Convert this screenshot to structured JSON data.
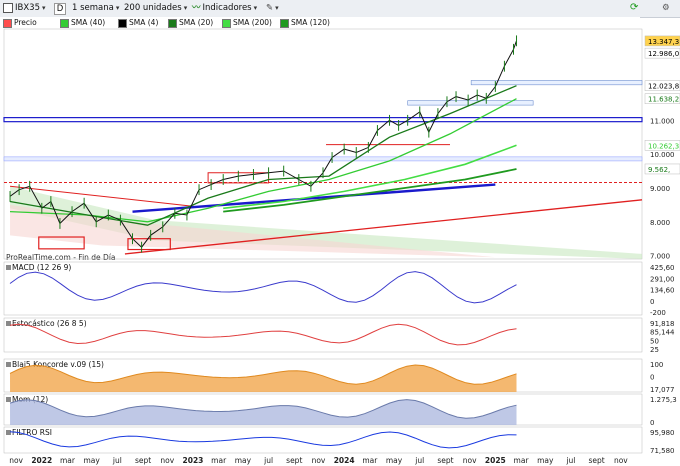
{
  "toolbar": {
    "symbol": "IBX35",
    "d_label": "D",
    "period": "1 semana",
    "units": "200 unidades",
    "indicators": "Indicadores"
  },
  "legend": [
    {
      "label": "Precio",
      "color": "#ff4d4d"
    },
    {
      "label": "SMA (40)",
      "color": "#33cc33"
    },
    {
      "label": "SMA (4)",
      "color": "#000000"
    },
    {
      "label": "SMA (20)",
      "color": "#1a7a1a"
    },
    {
      "label": "SMA (200)",
      "color": "#44dd44"
    },
    {
      "label": "SMA (120)",
      "color": "#1f9a1f"
    }
  ],
  "watermark": "ProRealTime.com - Fin de Día",
  "price_badges": [
    {
      "text": "13.347,3",
      "value": 13347.3,
      "bg": "#ffd24d",
      "fg": "#000"
    },
    {
      "text": "12.986,0",
      "value": 12986.0,
      "bg": "#ffffff",
      "fg": "#000"
    },
    {
      "text": "12.023,8",
      "value": 12023.8,
      "bg": "#ffffff",
      "fg": "#000"
    },
    {
      "text": "11.638,2",
      "value": 11638.2,
      "bg": "#ffffff",
      "fg": "#1a7a1a"
    },
    {
      "text": "10.262,3",
      "value": 10262.3,
      "bg": "#ffffff",
      "fg": "#33cc33"
    },
    {
      "text": "9.562,",
      "value": 9562,
      "bg": "#ffffff",
      "fg": "#1a7a1a"
    }
  ],
  "indicator_labels": {
    "macd": "MACD (12 26 9)",
    "stoch": "Estocástico (26 8 5)",
    "blai5": "Blai5 Koncorde v.09 (15)",
    "mom": "Mom (12)",
    "rsi": "FILTRO RSI"
  },
  "indicator_values": {
    "macd": [
      "425,60",
      "291,00",
      "134,60",
      "0",
      "-200"
    ],
    "stoch": [
      "91,818",
      "85,144",
      "50",
      "25"
    ],
    "blai5": [
      "100",
      "0",
      "17,077"
    ],
    "mom": [
      "1.275,3",
      "0"
    ],
    "rsi": [
      "95,980",
      "71,580"
    ]
  },
  "chart_data": {
    "type": "line",
    "title": "",
    "xlabel": "",
    "ylabel": "",
    "ylim": [
      6900,
      13700
    ],
    "y_ticks": [
      {
        "label": "13.347,3",
        "value": 13347.3
      },
      {
        "label": "12.986,0",
        "value": 12986
      },
      {
        "label": "12.023,8",
        "value": 12023.8
      },
      {
        "label": "11.638,2",
        "value": 11638.2
      },
      {
        "label": "11.000",
        "value": 11000
      },
      {
        "label": "10.262,3",
        "value": 10262.3
      },
      {
        "label": "10.000",
        "value": 10000
      },
      {
        "label": "9.562,",
        "value": 9562
      },
      {
        "label": "9.000",
        "value": 9000
      },
      {
        "label": "8.000",
        "value": 8000
      },
      {
        "label": "7.000",
        "value": 7000
      }
    ],
    "x_ticks": [
      "nov",
      "2022",
      "mar",
      "may",
      "jul",
      "sept",
      "nov",
      "2023",
      "mar",
      "may",
      "jul",
      "sept",
      "nov",
      "2024",
      "mar",
      "may",
      "jul",
      "sept",
      "nov",
      "2025",
      "mar",
      "may",
      "jul",
      "sept",
      "nov"
    ],
    "x_range": [
      2021.75,
      2025.97
    ],
    "grid": false,
    "price_line_series": {
      "name": "Precio",
      "x": [
        2021.79,
        2021.85,
        2021.92,
        2022.0,
        2022.06,
        2022.12,
        2022.2,
        2022.28,
        2022.36,
        2022.44,
        2022.52,
        2022.6,
        2022.66,
        2022.72,
        2022.8,
        2022.88,
        2022.96,
        2023.04,
        2023.12,
        2023.2,
        2023.3,
        2023.4,
        2023.5,
        2023.6,
        2023.7,
        2023.78,
        2023.86,
        2023.92,
        2024.0,
        2024.08,
        2024.16,
        2024.22,
        2024.3,
        2024.36,
        2024.42,
        2024.5,
        2024.56,
        2024.62,
        2024.68,
        2024.74,
        2024.82,
        2024.88,
        2024.94,
        2025.0,
        2025.06,
        2025.12,
        2025.14
      ],
      "values": [
        8750,
        8950,
        9050,
        8400,
        8600,
        7950,
        8300,
        8550,
        8000,
        8200,
        8050,
        7500,
        7250,
        7600,
        7850,
        8250,
        8200,
        8950,
        9100,
        9250,
        9350,
        9400,
        9450,
        9500,
        9250,
        9050,
        9450,
        9900,
        10150,
        10050,
        10200,
        10700,
        11000,
        10850,
        11000,
        11250,
        10650,
        11200,
        11550,
        11700,
        11600,
        11750,
        11650,
        12000,
        12600,
        13100,
        13350
      ]
    },
    "series": [
      {
        "name": "SMA (40)",
        "x": [
          2021.79,
          2022.3,
          2022.7,
          2023.1,
          2023.5,
          2023.9,
          2024.3,
          2024.7,
          2025.14
        ],
        "values": [
          8300,
          8200,
          8000,
          8400,
          8900,
          9250,
          9800,
          10600,
          11638.2
        ]
      },
      {
        "name": "SMA (20)",
        "x": [
          2021.79,
          2022.3,
          2022.7,
          2023.1,
          2023.5,
          2023.9,
          2024.3,
          2024.7,
          2025.14
        ],
        "values": [
          8600,
          8200,
          7900,
          8700,
          9250,
          9350,
          10500,
          11200,
          12023.8
        ]
      },
      {
        "name": "SMA (200)",
        "x": [
          2023.2,
          2023.6,
          2024.0,
          2024.4,
          2024.8,
          2025.14
        ],
        "values": [
          8400,
          8600,
          8900,
          9250,
          9700,
          10262.3
        ]
      },
      {
        "name": "SMA (120)",
        "x": [
          2023.2,
          2023.6,
          2024.0,
          2024.4,
          2024.8,
          2025.14
        ],
        "values": [
          8300,
          8500,
          8750,
          9000,
          9250,
          9562
        ]
      }
    ],
    "indicators": [
      {
        "name": "MACD (12 26 9)",
        "ylim": [
          -300,
          500
        ]
      },
      {
        "name": "Estocástico (26 8 5)",
        "ylim": [
          0,
          100
        ]
      },
      {
        "name": "Blai5 Koncorde v.09 (15)",
        "ylim": [
          -20,
          130
        ]
      },
      {
        "name": "Mom (12)",
        "ylim": [
          -900,
          1500
        ]
      },
      {
        "name": "FILTRO RSI",
        "ylim": [
          0,
          100
        ]
      }
    ]
  }
}
